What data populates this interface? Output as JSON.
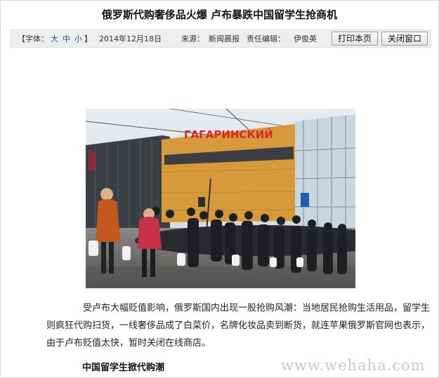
{
  "article": {
    "headline": "俄罗斯代购奢侈品火爆 卢布暴跌中国留学生抢商机",
    "body": "受卢布大幅贬值影响，俄罗斯国内出现一股抢购风潮：当地居民抢购生活用品，留学生则疯狂代购扫货，一线奢侈品成了白菜价，名牌化妆品卖到断货，就连苹果俄罗斯官网也表示，由于卢布贬值太快，暂时关闭在线商店。",
    "subhead": "中国留学生掀代购潮"
  },
  "meta": {
    "font_prefix": "【字体：",
    "font_large": "大",
    "font_medium": "中",
    "font_small": "小",
    "font_suffix": "】",
    "date": "2014年12月18日",
    "source_label": "来源：",
    "source": "新闻晨报",
    "editor_label": "责任编辑：",
    "editor": "伊俊英"
  },
  "buttons": {
    "print": "打印本页",
    "close": "关闭窗口"
  },
  "photo": {
    "sign_text": "ГАГАРИНСКИЙ",
    "sign_color": "#d9262c",
    "facade_color": "#d69a3a"
  },
  "watermark": "www.wehaha.com"
}
